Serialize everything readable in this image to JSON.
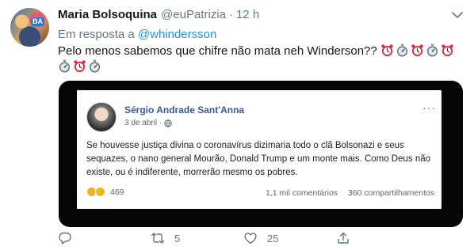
{
  "tweet": {
    "display_name": "Maria Bolsoquina",
    "handle": "@euPatrizia",
    "separator": "·",
    "time": "12 h",
    "reply_prefix": "Em resposta a",
    "reply_to": "@whindersson",
    "text": "Pelo menos sabemos que chifre não mata neh Winderson??",
    "emojis_line1": [
      "alarm-clock",
      "stopwatch",
      "alarm-clock",
      "stopwatch",
      "alarm-clock"
    ],
    "emojis_line2": [
      "stopwatch",
      "alarm-clock",
      "stopwatch"
    ]
  },
  "embedded_post": {
    "author": "Sérgio Andrade Sant'Anna",
    "date": "3 de abril ·",
    "more": "···",
    "body": "Se houvesse justiça divina o coronavírus dizimaria todo o clã Bolsonazi e seus sequazes, o nano general Mourão, Donald Trump e um monte mais. Como Deus não existe, ou é indiferente, morrerão mesmo os pobres.",
    "reaction_count": "469",
    "comments": "1,1 mil comentários",
    "shares": "360 compartilhamentos"
  },
  "actions": {
    "reply_count": "",
    "retweet_count": "5",
    "like_count": "25"
  },
  "colors": {
    "link": "#1b95e0",
    "muted": "#657786",
    "fb_name": "#385898"
  }
}
